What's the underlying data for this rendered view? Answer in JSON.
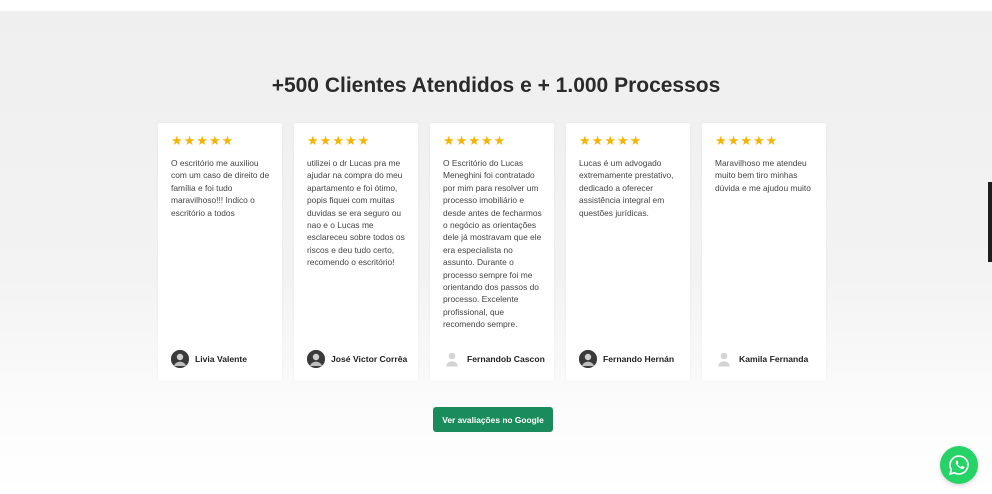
{
  "heading": "+500 Clientes Atendidos e + 1.000 Processos",
  "reviews": [
    {
      "stars": 5,
      "text": "O escritório me auxiliou com um caso de direito de família e foi tudo maravilhoso!!! Indico o escritório a todos",
      "author": "Livia Valente",
      "avatar": "photo"
    },
    {
      "stars": 5,
      "text": "utilizei o dr Lucas pra me ajudar na compra do meu apartamento e foi ótimo, popis fiquei com muitas duvidas se era seguro ou nao e o Lucas me esclareceu sobre todos os riscos e deu tudo certo, recomendo o escritório!",
      "author": "José Victor Corrêa",
      "avatar": "photo"
    },
    {
      "stars": 5,
      "text": "O Escritório do Lucas Meneghini foi contratado por mim para resolver um processo imobiliário e desde antes de fecharmos o negócio as orientações dele já mostravam que ele era especialista no assunto. Durante o processo sempre foi me orientando dos passos do processo. Excelente profissional, que recomendo sempre.",
      "author": "Fernandob Cascon",
      "avatar": "placeholder"
    },
    {
      "stars": 5,
      "text": "Lucas é um advogado extremamente prestativo, dedicado a oferecer assistência integral em questões jurídicas.",
      "author": "Fernando Hernán",
      "avatar": "photo"
    },
    {
      "stars": 5,
      "text": "Maravilhoso me atendeu muito bem tiro minhas dúvida e me ajudou muito",
      "author": "Kamila Fernanda",
      "avatar": "placeholder"
    }
  ],
  "cta_label": "Ver avaliações no Google",
  "colors": {
    "star": "#f6b400",
    "cta": "#1a8c5b",
    "whatsapp": "#25d366"
  },
  "icons": {
    "star": "star-icon",
    "whatsapp": "whatsapp-icon",
    "avatar_placeholder": "user-placeholder-icon"
  }
}
